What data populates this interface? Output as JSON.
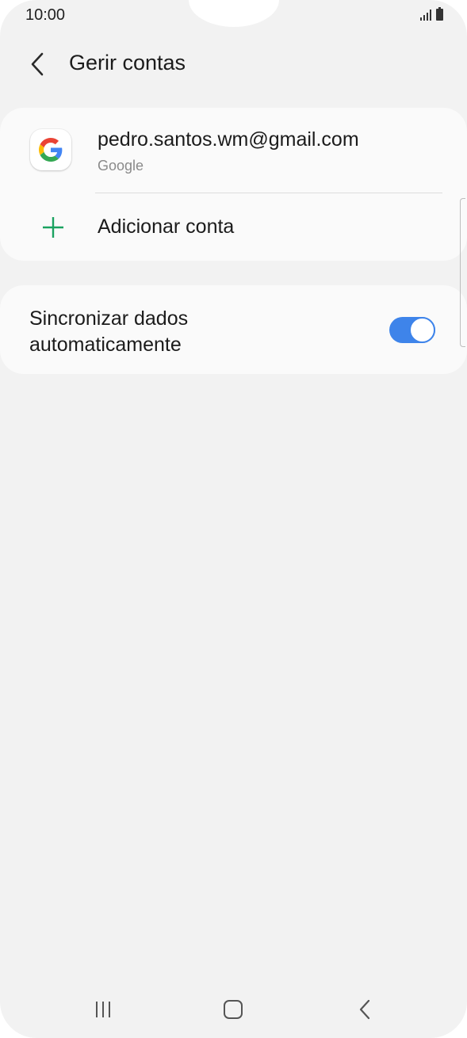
{
  "status_bar": {
    "time": "10:00",
    "icons": [
      "signal-icon",
      "battery-icon"
    ]
  },
  "header": {
    "title": "Gerir contas",
    "back_icon": "chevron-left-icon"
  },
  "accounts": [
    {
      "email": "pedro.santos.wm@gmail.com",
      "type": "Google",
      "icon": "google-icon"
    }
  ],
  "add_account": {
    "label": "Adicionar conta",
    "icon": "plus-icon",
    "icon_color": "#1aa260"
  },
  "sync": {
    "label": "Sincronizar dados automaticamente",
    "enabled": true,
    "accent": "#3e84ea"
  },
  "nav_bar": {
    "icons": [
      "recents-icon",
      "home-icon",
      "back-icon"
    ]
  }
}
